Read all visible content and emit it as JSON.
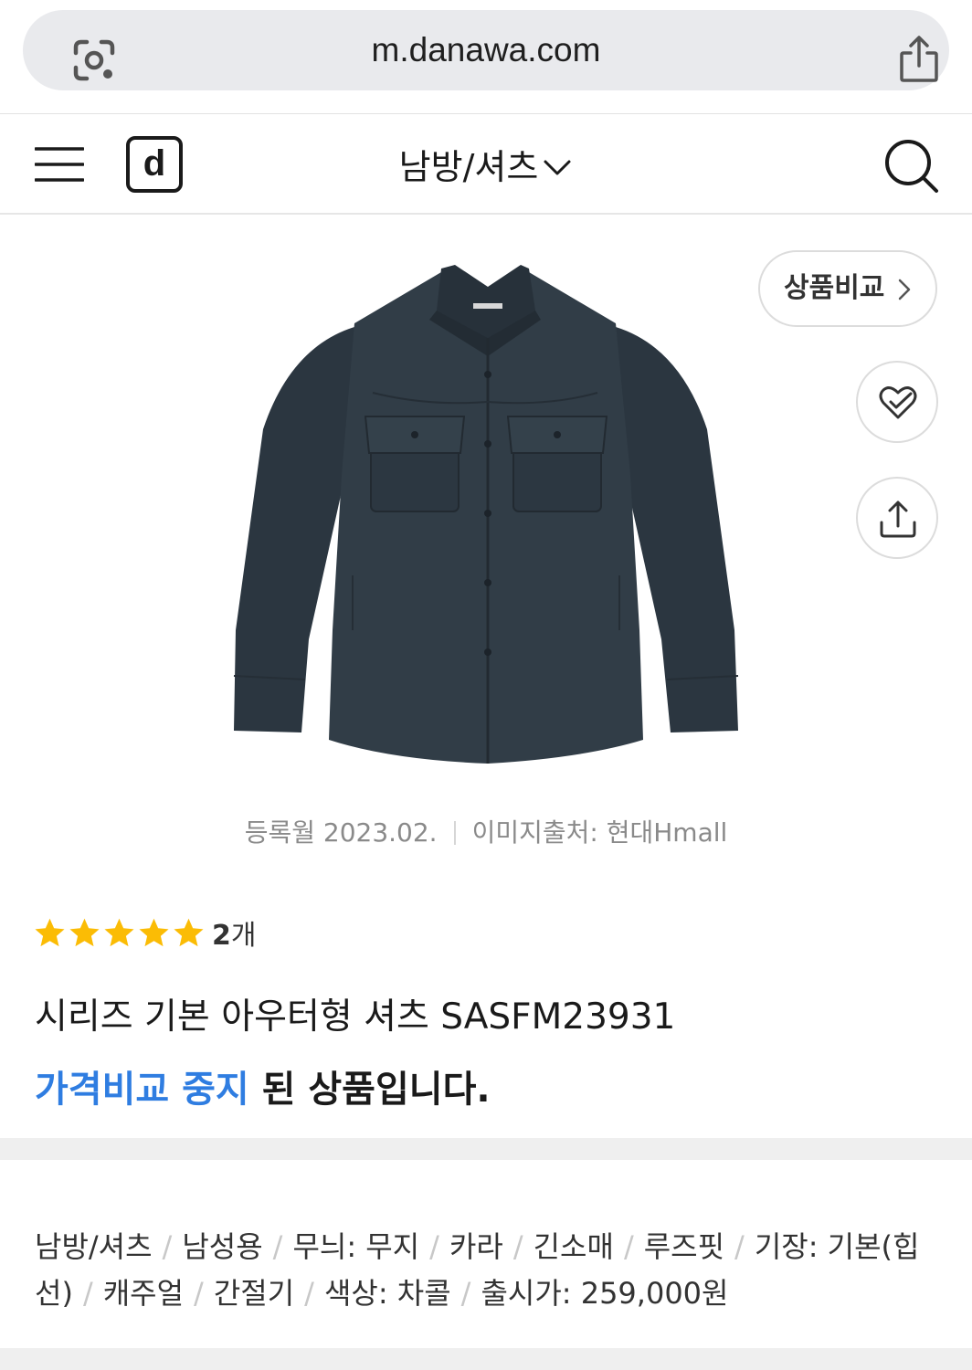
{
  "browser": {
    "url": "m.danawa.com"
  },
  "header": {
    "logo_letter": "d",
    "category": "남방/셔츠"
  },
  "product": {
    "compare_label": "상품비교",
    "registered": "등록월 2023.02.",
    "image_source": "이미지출처: 현대Hmall",
    "rating_stars": 5,
    "review_count": "2",
    "review_unit": "개",
    "name": "시리즈 기본 아우터형 셔츠 SASFM23931",
    "status_highlight": "가격비교 중지",
    "status_rest": " 된 상품입니다."
  },
  "specs": [
    "남방/셔츠",
    "남성용",
    "무늬: 무지",
    "카라",
    "긴소매",
    "루즈핏",
    "기장: 기본(힙선)",
    "캐주얼",
    "간절기",
    "색상: 차콜",
    "출시가: 259,000원"
  ],
  "colors": {
    "accent": "#2f7de1",
    "star": "#fbbc05",
    "shirt": "#2e3a44"
  }
}
